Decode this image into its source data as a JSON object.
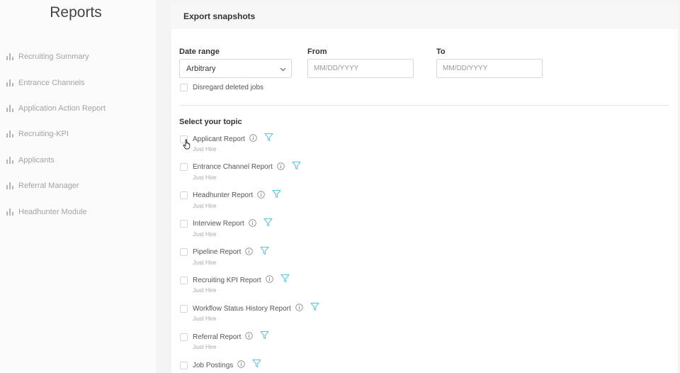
{
  "sidebar": {
    "title": "Reports",
    "items": [
      {
        "label": "Recruiting Summary",
        "icon": "bar-chart-icon"
      },
      {
        "label": "Entrance Channels",
        "icon": "bar-chart-icon"
      },
      {
        "label": "Application Action Report",
        "icon": "bar-chart-icon"
      },
      {
        "label": "Recruiting-KPI",
        "icon": "bar-chart-icon"
      },
      {
        "label": "Applicants",
        "icon": "bar-chart-icon"
      },
      {
        "label": "Referral Manager",
        "icon": "bar-chart-icon"
      },
      {
        "label": "Headhunter Module",
        "icon": "bar-chart-icon"
      }
    ]
  },
  "panel": {
    "title": "Export snapshots",
    "date_range": {
      "label": "Date range",
      "value": "Arbitrary"
    },
    "from": {
      "label": "From",
      "placeholder": "MM/DD/YYYY"
    },
    "to": {
      "label": "To",
      "placeholder": "MM/DD/YYYY"
    },
    "disregard_label": "Disregard deleted jobs",
    "topic_title": "Select your topic",
    "topics": [
      {
        "name": "Applicant Report",
        "sub": "Just Hire"
      },
      {
        "name": "Entrance Channel Report",
        "sub": "Just Hire"
      },
      {
        "name": "Headhunter Report",
        "sub": "Just Hire"
      },
      {
        "name": "Interview Report",
        "sub": "Just Hire"
      },
      {
        "name": "Pipeline Report",
        "sub": "Just Hire"
      },
      {
        "name": "Recruiting KPI Report",
        "sub": "Just Hire"
      },
      {
        "name": "Workflow Status History Report",
        "sub": "Just Hire"
      },
      {
        "name": "Referral Report",
        "sub": "Just Hire"
      },
      {
        "name": "Job Postings",
        "sub": ""
      }
    ]
  },
  "colors": {
    "sidebar_bg": "#fbfbfb",
    "nav_text": "#a3a3a3",
    "filter_icon": "#5bc4d8",
    "main_bg": "#f4f4f4"
  }
}
